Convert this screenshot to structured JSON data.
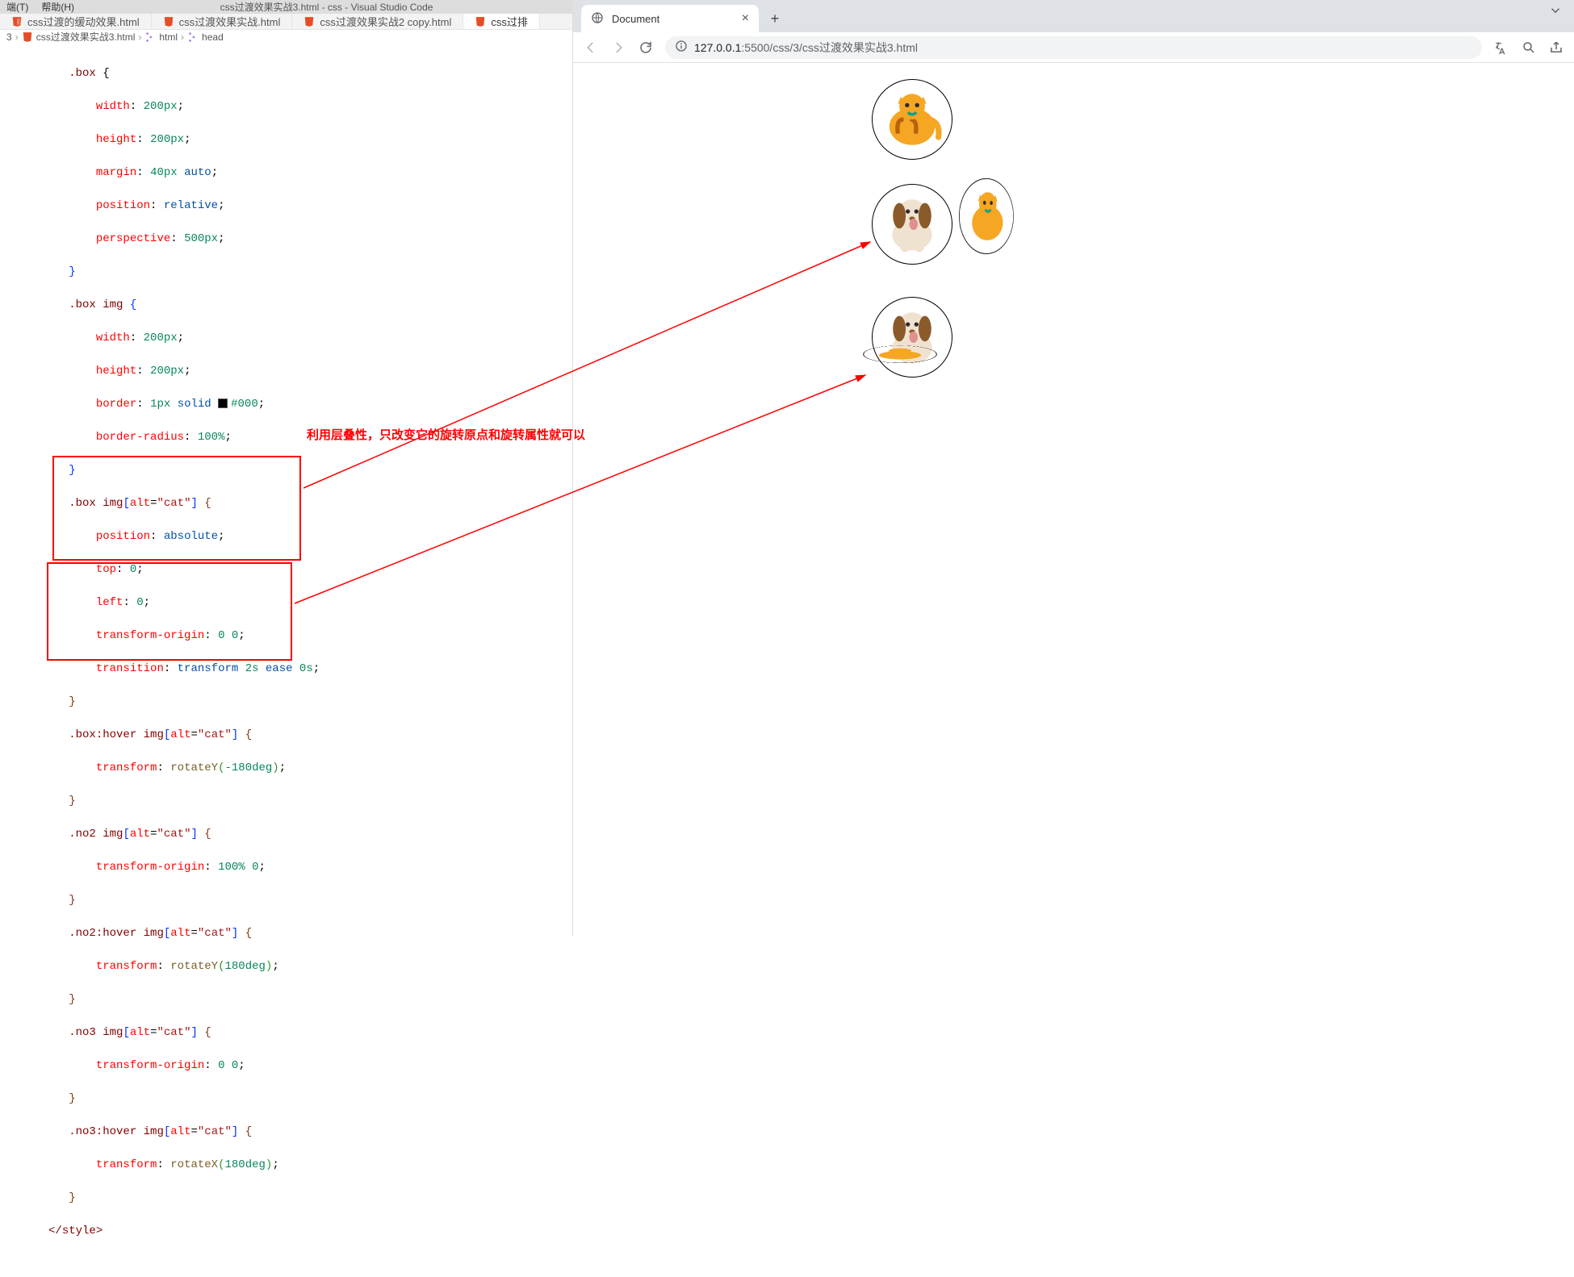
{
  "vscode": {
    "menu": {
      "terminal": "端(T)",
      "help": "帮助(H)"
    },
    "title": "css过渡效果实战3.html - css - Visual Studio Code",
    "tabs": [
      {
        "label": "css过渡的缓动效果.html",
        "active": false
      },
      {
        "label": "css过渡效果实战.html",
        "active": false
      },
      {
        "label": "css过渡效果实战2 copy.html",
        "active": false
      },
      {
        "label": "css过排",
        "active": true
      }
    ],
    "breadcrumbs": {
      "bc0": "3",
      "bc1": "css过渡效果实战3.html",
      "bc2": "html",
      "bc3": "head"
    }
  },
  "code": {
    "l01a": ".box",
    "l01b": " {",
    "l02a": "width",
    "l02b": ": ",
    "l02c": "200px",
    "l02d": ";",
    "l03a": "height",
    "l03b": ": ",
    "l03c": "200px",
    "l03d": ";",
    "l04a": "margin",
    "l04b": ": ",
    "l04c": "40px",
    "l04d": " ",
    "l04e": "auto",
    "l04f": ";",
    "l05a": "position",
    "l05b": ": ",
    "l05c": "relative",
    "l05d": ";",
    "l06a": "perspective",
    "l06b": ": ",
    "l06c": "500px",
    "l06d": ";",
    "l07a": "}",
    "l08a": ".box",
    "l08b": " ",
    "l08c": "img",
    "l08d": " {",
    "l09a": "width",
    "l09b": ": ",
    "l09c": "200px",
    "l09d": ";",
    "l10a": "height",
    "l10b": ": ",
    "l10c": "200px",
    "l10d": ";",
    "l11a": "border",
    "l11b": ": ",
    "l11c": "1px",
    "l11d": " ",
    "l11e": "solid",
    "l11f": " ",
    "l11g": "#000",
    "l11h": ";",
    "l12a": "border-radius",
    "l12b": ": ",
    "l12c": "100%",
    "l12d": ";",
    "l13a": "}",
    "l14a": ".box",
    "l14b": " ",
    "l14c": "img",
    "l14d": "[",
    "l14e": "alt",
    "l14f": "=",
    "l14g": "\"cat\"",
    "l14h": "]",
    "l14i": " {",
    "l15a": "position",
    "l15b": ": ",
    "l15c": "absolute",
    "l15d": ";",
    "l16a": "top",
    "l16b": ": ",
    "l16c": "0",
    "l16d": ";",
    "l17a": "left",
    "l17b": ": ",
    "l17c": "0",
    "l17d": ";",
    "l18a": "transform-origin",
    "l18b": ": ",
    "l18c": "0",
    "l18d": " ",
    "l18e": "0",
    "l18f": ";",
    "l19a": "transition",
    "l19b": ": ",
    "l19c": "transform",
    "l19d": " ",
    "l19e": "2s",
    "l19f": " ",
    "l19g": "ease",
    "l19h": " ",
    "l19i": "0s",
    "l19j": ";",
    "l20a": "}",
    "l21a": ".box:hover",
    "l21b": " ",
    "l21c": "img",
    "l21d": "[",
    "l21e": "alt",
    "l21f": "=",
    "l21g": "\"cat\"",
    "l21h": "]",
    "l21i": " {",
    "l22a": "transform",
    "l22b": ": ",
    "l22c": "rotateY",
    "l22d": "(",
    "l22e": "-180deg",
    "l22f": ")",
    "l22g": ";",
    "l23a": "}",
    "l24a": ".no2",
    "l24b": " ",
    "l24c": "img",
    "l24d": "[",
    "l24e": "alt",
    "l24f": "=",
    "l24g": "\"cat\"",
    "l24h": "]",
    "l24i": " {",
    "l25a": "transform-origin",
    "l25b": ": ",
    "l25c": "100%",
    "l25d": " ",
    "l25e": "0",
    "l25f": ";",
    "l26a": "}",
    "l27a": ".no2:hover",
    "l27b": " ",
    "l27c": "img",
    "l27d": "[",
    "l27e": "alt",
    "l27f": "=",
    "l27g": "\"cat\"",
    "l27h": "]",
    "l27i": " {",
    "l28a": "transform",
    "l28b": ": ",
    "l28c": "rotateY",
    "l28d": "(",
    "l28e": "180deg",
    "l28f": ")",
    "l28g": ";",
    "l29a": "}",
    "l30a": ".no3",
    "l30b": " ",
    "l30c": "img",
    "l30d": "[",
    "l30e": "alt",
    "l30f": "=",
    "l30g": "\"cat\"",
    "l30h": "]",
    "l30i": " {",
    "l31a": "transform-origin",
    "l31b": ": ",
    "l31c": "0",
    "l31d": " ",
    "l31e": "0",
    "l31f": ";",
    "l32a": "}",
    "l33a": ".no3:hover",
    "l33b": " ",
    "l33c": "img",
    "l33d": "[",
    "l33e": "alt",
    "l33f": "=",
    "l33g": "\"cat\"",
    "l33h": "]",
    "l33i": " {",
    "l34a": "transform",
    "l34b": ": ",
    "l34c": "rotateX",
    "l34d": "(",
    "l34e": "180deg",
    "l34f": ")",
    "l34g": ";",
    "l35a": "}",
    "l36a": "</",
    "l36b": "style",
    "l36c": ">"
  },
  "annotation": {
    "text": "利用层叠性，只改变它的旋转原点和旋转属性就可以"
  },
  "browser": {
    "tab_title": "Document",
    "url_prefix": "127.0.0.1",
    "url_path": ":5500/css/3/css过渡效果实战3.html"
  }
}
